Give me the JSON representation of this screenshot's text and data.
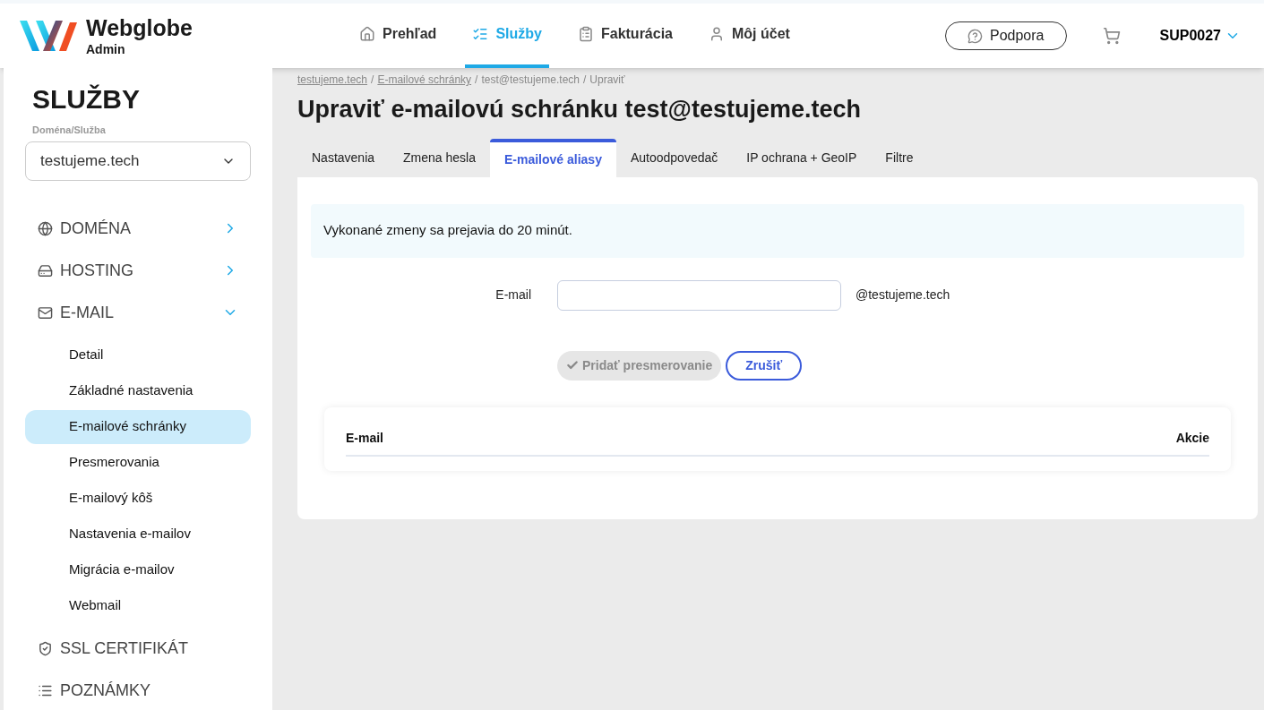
{
  "header": {
    "brand": "Webglobe",
    "subtitle": "Admin",
    "nav": [
      {
        "label": "Prehľad",
        "kind": "home",
        "selected": false
      },
      {
        "label": "Služby",
        "kind": "services",
        "selected": true
      },
      {
        "label": "Fakturácia",
        "kind": "billing",
        "selected": false
      },
      {
        "label": "Môj účet",
        "kind": "account",
        "selected": false
      }
    ],
    "support": "Podpora",
    "user": "SUP0027"
  },
  "sidebar": {
    "title": "SLUŽBY",
    "select_label": "Doména/Služba",
    "select_value": "testujeme.tech",
    "sections": [
      {
        "label": "DOMÉNA",
        "kind": "globe",
        "expanded": false
      },
      {
        "label": "HOSTING",
        "kind": "drive",
        "expanded": false
      },
      {
        "label": "E-MAIL",
        "kind": "mail",
        "expanded": true,
        "children": [
          {
            "label": "Detail",
            "selected": false
          },
          {
            "label": "Základné nastavenia",
            "selected": false
          },
          {
            "label": "E-mailové schránky",
            "selected": true
          },
          {
            "label": "Presmerovania",
            "selected": false
          },
          {
            "label": "E-mailový kôš",
            "selected": false
          },
          {
            "label": "Nastavenia e-mailov",
            "selected": false
          },
          {
            "label": "Migrácia e-mailov",
            "selected": false
          },
          {
            "label": "Webmail",
            "selected": false
          }
        ]
      },
      {
        "label": "SSL CERTIFIKÁT",
        "kind": "shield"
      },
      {
        "label": "POZNÁMKY",
        "kind": "list"
      }
    ]
  },
  "breadcrumb": {
    "separator": "/",
    "items": [
      "testujeme.tech",
      "E-mailové schránky",
      "test@testujeme.tech",
      "Upraviť"
    ]
  },
  "page_title": "Upraviť e-mailovú schránku test@testujeme.tech",
  "tabs": [
    {
      "label": "Nastavenia",
      "selected": false
    },
    {
      "label": "Zmena hesla",
      "selected": false
    },
    {
      "label": "E-mailové aliasy",
      "selected": true
    },
    {
      "label": "Autoodpovedač",
      "selected": false
    },
    {
      "label": "IP ochrana + GeoIP",
      "selected": false
    },
    {
      "label": "Filtre",
      "selected": false
    }
  ],
  "notice": "Vykonané zmeny sa prejavia do 20 minút.",
  "form": {
    "label": "E-mail",
    "suffix": "@testujeme.tech",
    "submit": {
      "label": "Pridať presmerovanie",
      "disabled": true
    },
    "cancel": "Zrušiť"
  },
  "table": {
    "columns": [
      "E-mail",
      "Akcie"
    ]
  }
}
